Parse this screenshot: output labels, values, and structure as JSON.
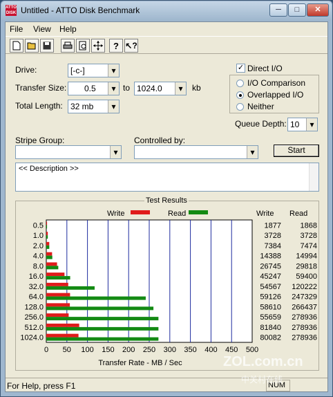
{
  "window": {
    "title": "Untitled - ATTO Disk Benchmark",
    "icon_text": "ATTO DISK",
    "minimize": "─",
    "maximize": "□",
    "close": "✕"
  },
  "menu": [
    "File",
    "View",
    "Help"
  ],
  "toolbar": [
    "new-icon",
    "open-icon",
    "save-icon",
    "print-icon",
    "print-preview-icon",
    "move-icon",
    "help-icon",
    "context-help-icon"
  ],
  "form": {
    "drive_label": "Drive:",
    "drive_value": "[-c-]",
    "transfer_label": "Transfer Size:",
    "transfer_from": "0.5",
    "to_label": "to",
    "transfer_to": "1024.0",
    "kb_label": "kb",
    "length_label": "Total Length:",
    "length_value": "32 mb",
    "direct_io_label": "Direct I/O",
    "io_comparison_label": "I/O Comparison",
    "overlapped_io_label": "Overlapped I/O",
    "neither_label": "Neither",
    "queue_label": "Queue Depth:",
    "queue_value": "10",
    "stripe_label": "Stripe Group:",
    "controlled_label": "Controlled by:",
    "start_label": "Start",
    "description": "<< Description >>"
  },
  "results": {
    "title": "Test Results",
    "legend_write": "Write",
    "legend_read": "Read",
    "col_write": "Write",
    "col_read": "Read"
  },
  "chart_data": {
    "type": "bar",
    "orientation": "horizontal",
    "title": "Test Results",
    "xlabel": "Transfer Rate - MB / Sec",
    "ylabel": "",
    "xlim": [
      0,
      500
    ],
    "xticks": [
      0,
      50,
      100,
      150,
      200,
      250,
      300,
      350,
      400,
      450,
      500
    ],
    "categories": [
      "0.5",
      "1.0",
      "2.0",
      "4.0",
      "8.0",
      "16.0",
      "32.0",
      "64.0",
      "128.0",
      "256.0",
      "512.0",
      "1024.0"
    ],
    "series": [
      {
        "name": "Write",
        "color": "#e01b1b",
        "values": [
          1877,
          3728,
          7384,
          14388,
          26745,
          45247,
          54567,
          59126,
          58610,
          55659,
          81840,
          80082
        ]
      },
      {
        "name": "Read",
        "color": "#138a13",
        "values": [
          1868,
          3728,
          7474,
          14994,
          29818,
          59400,
          120222,
          247329,
          266437,
          278936,
          278936,
          278936
        ]
      }
    ],
    "grid": true,
    "legend": "top"
  },
  "status": {
    "text": "For Help, press F1",
    "num": "NUM"
  },
  "watermark": {
    "text": "ZOL.com.cn",
    "sub": "中关村在线"
  }
}
